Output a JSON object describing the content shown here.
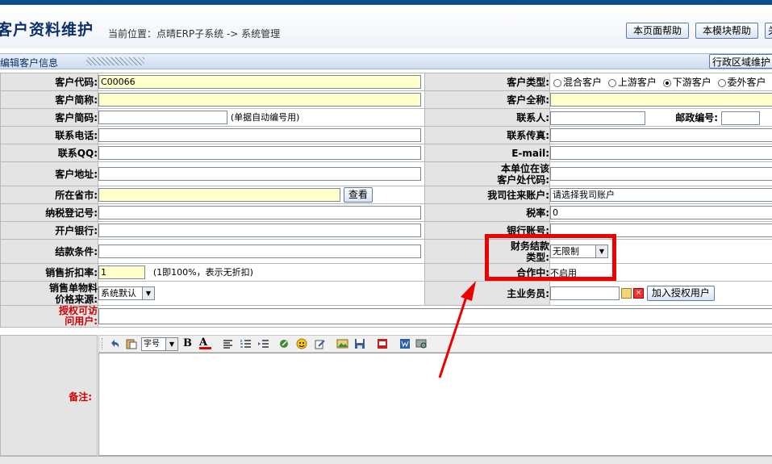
{
  "header": {
    "title": "客户资料维护",
    "breadcrumb": "当前位置：点晴ERP子系统 -> 系统管理",
    "buttons": [
      "本页面帮助",
      "本模块帮助",
      "关"
    ]
  },
  "section": {
    "title": "编辑客户信息",
    "button": "行政区域维护"
  },
  "form": {
    "customer_code": {
      "label": "客户代码:",
      "value": "C00066"
    },
    "customer_type": {
      "label": "客户类型:",
      "options": [
        "混合客户",
        "上游客户",
        "下游客户",
        "委外客户"
      ],
      "selected": "下游客户"
    },
    "short_name": {
      "label": "客户简称:",
      "value": ""
    },
    "full_name": {
      "label": "客户全称:",
      "value": ""
    },
    "short_code": {
      "label": "客户简码:",
      "value": "",
      "hint": "(单据自动编号用)"
    },
    "contact": {
      "label": "联系人:",
      "value": ""
    },
    "postcode": {
      "label": "邮政编号:",
      "value": ""
    },
    "phone": {
      "label": "联系电话:",
      "value": ""
    },
    "fax": {
      "label": "联系传真:",
      "value": ""
    },
    "qq": {
      "label": "联系QQ:",
      "value": ""
    },
    "email": {
      "label": "E-mail:",
      "value": ""
    },
    "address": {
      "label": "客户地址:",
      "value": ""
    },
    "our_code": {
      "label_line1": "本单位在该",
      "label_line2": "客户处代码:",
      "value": ""
    },
    "province": {
      "label": "所在省市:",
      "value": "",
      "button": "查看"
    },
    "our_account": {
      "label": "我司往来账户:",
      "value": "请选择我司账户"
    },
    "tax_reg": {
      "label": "纳税登记号:",
      "value": ""
    },
    "tax_rate": {
      "label": "税率:",
      "value": "0"
    },
    "bank": {
      "label": "开户银行:",
      "value": ""
    },
    "bank_account": {
      "label": "银行账号:",
      "value": ""
    },
    "settle_terms": {
      "label": "结款条件:",
      "value": ""
    },
    "finance_settle": {
      "label_line1": "财务结款",
      "label_line2": "类型:",
      "value": "无限制"
    },
    "discount": {
      "label": "销售折扣率:",
      "value": "1",
      "hint": "(1即100%，表示无折扣)"
    },
    "cooperating": {
      "label": "合作中:",
      "value": "不启用"
    },
    "price_source": {
      "label_line1": "销售单物料",
      "label_line2": "价格来源:",
      "value": "系统默认"
    },
    "salesman": {
      "label": "主业务员:",
      "value": "",
      "button": "加入授权用户"
    },
    "auth_users": {
      "label_line1": "授权可访",
      "label_line2": "问用户:",
      "value": ""
    },
    "remark": {
      "label": "备注:",
      "font_select": "字号"
    }
  },
  "colors": {
    "accent": "#0b4f8a",
    "label_bg": "#e4e4e4",
    "required_bg": "#ffffcc",
    "highlight": "#ee0000"
  }
}
